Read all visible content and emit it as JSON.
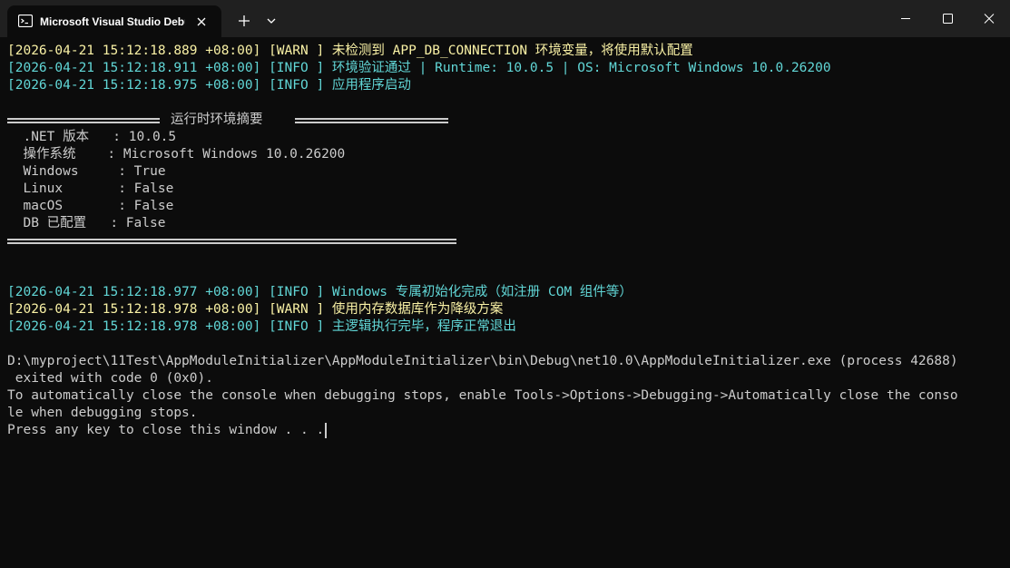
{
  "window": {
    "tab_title": "Microsoft Visual Studio Debug Console",
    "tab_icon": "terminal-icon",
    "colors": {
      "titlebar": "#202020",
      "background": "#0c0c0c",
      "text": "#cccccc",
      "warn": "#f9f1a5",
      "info": "#61d6d6"
    }
  },
  "log_top": [
    {
      "level": "warn",
      "text": "[2026-04-21 15:12:18.889 +08:00] [WARN ] 未检测到 APP_DB_CONNECTION 环境变量，将使用默认配置"
    },
    {
      "level": "info",
      "text": "[2026-04-21 15:12:18.911 +08:00] [INFO ] 环境验证通过 | Runtime: 10.0.5 | OS: Microsoft Windows 10.0.26200"
    },
    {
      "level": "info",
      "text": "[2026-04-21 15:12:18.975 +08:00] [INFO ] 应用程序启动"
    }
  ],
  "summary": {
    "title": "运行时环境摘要",
    "rows": [
      "  .NET 版本   : 10.0.5",
      "  操作系统    : Microsoft Windows 10.0.26200",
      "  Windows     : True",
      "  Linux       : False",
      "  macOS       : False",
      "  DB 已配置   : False"
    ]
  },
  "log_bottom": [
    {
      "level": "info",
      "text": "[2026-04-21 15:12:18.977 +08:00] [INFO ] Windows 专属初始化完成（如注册 COM 组件等）"
    },
    {
      "level": "warn",
      "text": "[2026-04-21 15:12:18.978 +08:00] [WARN ] 使用内存数据库作为降级方案"
    },
    {
      "level": "info",
      "text": "[2026-04-21 15:12:18.978 +08:00] [INFO ] 主逻辑执行完毕，程序正常退出"
    }
  ],
  "exit_lines": [
    "D:\\myproject\\11Test\\AppModuleInitializer\\AppModuleInitializer\\bin\\Debug\\net10.0\\AppModuleInitializer.exe (process 42688)",
    " exited with code 0 (0x0).",
    "To automatically close the console when debugging stops, enable Tools->Options->Debugging->Automatically close the conso",
    "le when debugging stops.",
    "Press any key to close this window . . ."
  ]
}
